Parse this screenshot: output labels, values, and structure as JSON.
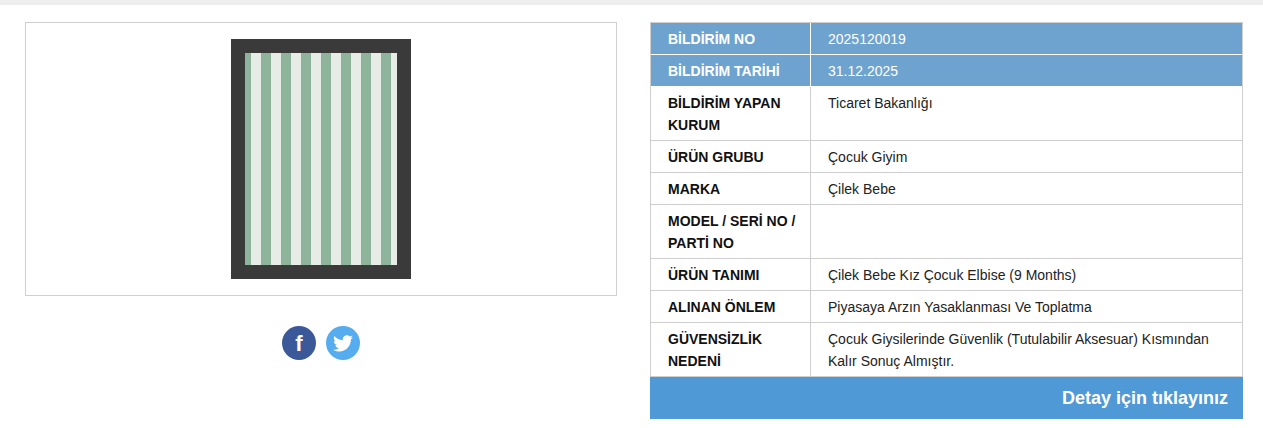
{
  "image": {
    "alt": ""
  },
  "social": {
    "facebook": "f"
  },
  "table": {
    "rows": [
      {
        "label": "BİLDİRİM NO",
        "value": "2025120019",
        "kind": "header"
      },
      {
        "label": "BİLDİRİM TARİHİ",
        "value": "31.12.2025",
        "kind": "header"
      },
      {
        "label": "BİLDİRİM YAPAN KURUM",
        "value": "Ticaret Bakanlığı",
        "kind": "plain"
      },
      {
        "label": "ÜRÜN GRUBU",
        "value": "Çocuk Giyim",
        "kind": "plain"
      },
      {
        "label": "MARKA",
        "value": "Çilek Bebe",
        "kind": "plain"
      },
      {
        "label": "MODEL / SERİ NO / PARTİ NO",
        "value": "",
        "kind": "plain"
      },
      {
        "label": "ÜRÜN TANIMI",
        "value": "Çilek Bebe Kız Çocuk Elbise (9 Months)",
        "kind": "plain"
      },
      {
        "label": "ALINAN ÖNLEM",
        "value": "Piyasaya Arzın Yasaklanması Ve Toplatma",
        "kind": "plain"
      },
      {
        "label": "GÜVENSİZLİK NEDENİ",
        "value": "Çocuk Giysilerinde Güvenlik (Tutulabilir Aksesuar) Kısmından Kalır Sonuç Almıştır.",
        "kind": "plain"
      }
    ]
  },
  "footer": {
    "label": "Detay için tıklayınız"
  }
}
